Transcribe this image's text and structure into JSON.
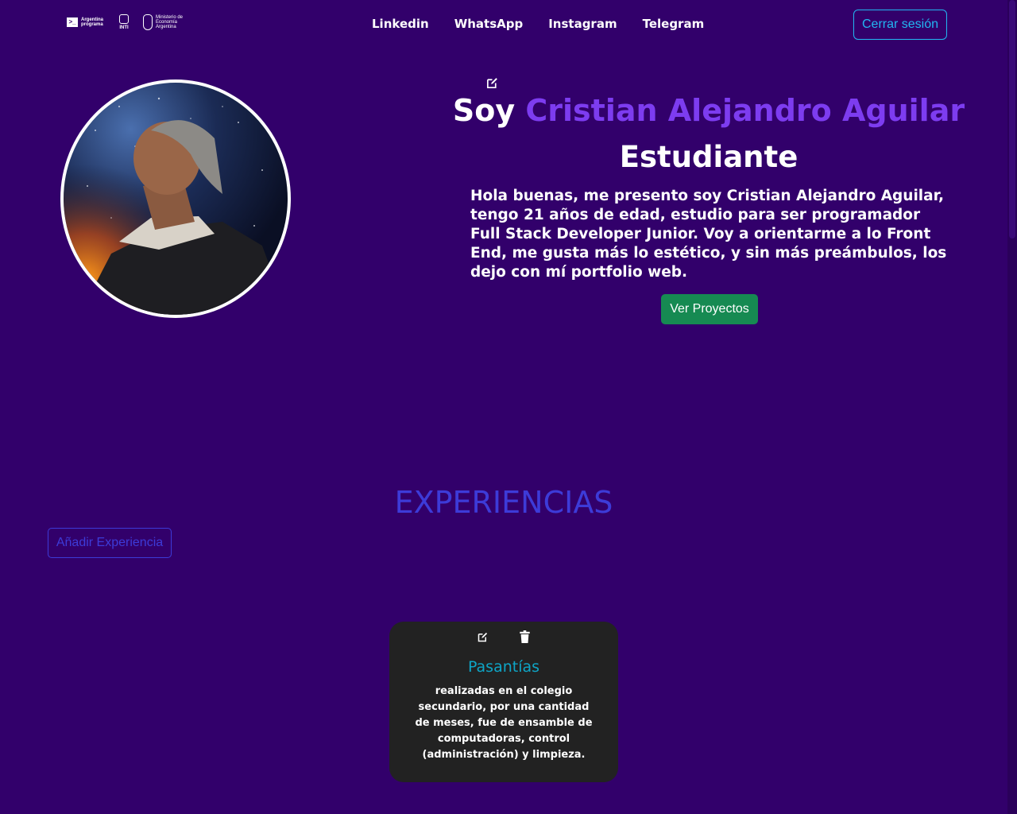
{
  "header": {
    "logos": [
      {
        "name": "argentina-programa-logo",
        "text": "Argentina programa"
      },
      {
        "name": "inti-logo",
        "text": "INTI"
      },
      {
        "name": "ministerio-logo",
        "text": "Ministerio de Economía Argentina"
      }
    ],
    "nav": [
      "Linkedin",
      "WhatsApp",
      "Instagram",
      "Telegram"
    ],
    "logout_label": "Cerrar sesión"
  },
  "profile": {
    "greeting": "Soy ",
    "name": "Cristian Alejandro Aguilar",
    "role": "Estudiante",
    "description": "Hola buenas, me presento soy Cristian Alejandro Aguilar, tengo 21 años de edad, estudio para ser programador Full Stack Developer Junior. Voy a orientarme a lo Front End, me gusta más lo estético, y sin más preámbulos, los dejo con mí portfolio web.",
    "projects_button": "Ver Proyectos"
  },
  "experience": {
    "title": "EXPERIENCIAS",
    "add_button": "Añadir Experiencia",
    "items": [
      {
        "title": "Pasantías",
        "description": "realizadas en el colegio secundario, por una cantidad de meses, fue de ensamble de computadoras, control (administración) y limpieza."
      }
    ]
  },
  "colors": {
    "background": "#32006b",
    "accent_name": "#7d3cf0",
    "logout_border": "#22b7f2",
    "projects_button": "#168a52",
    "section_title": "#3d3bd8",
    "card_bg": "#222222",
    "card_title": "#0ea5c6"
  },
  "icons": {
    "edit": "edit-icon",
    "delete": "trash-icon"
  }
}
